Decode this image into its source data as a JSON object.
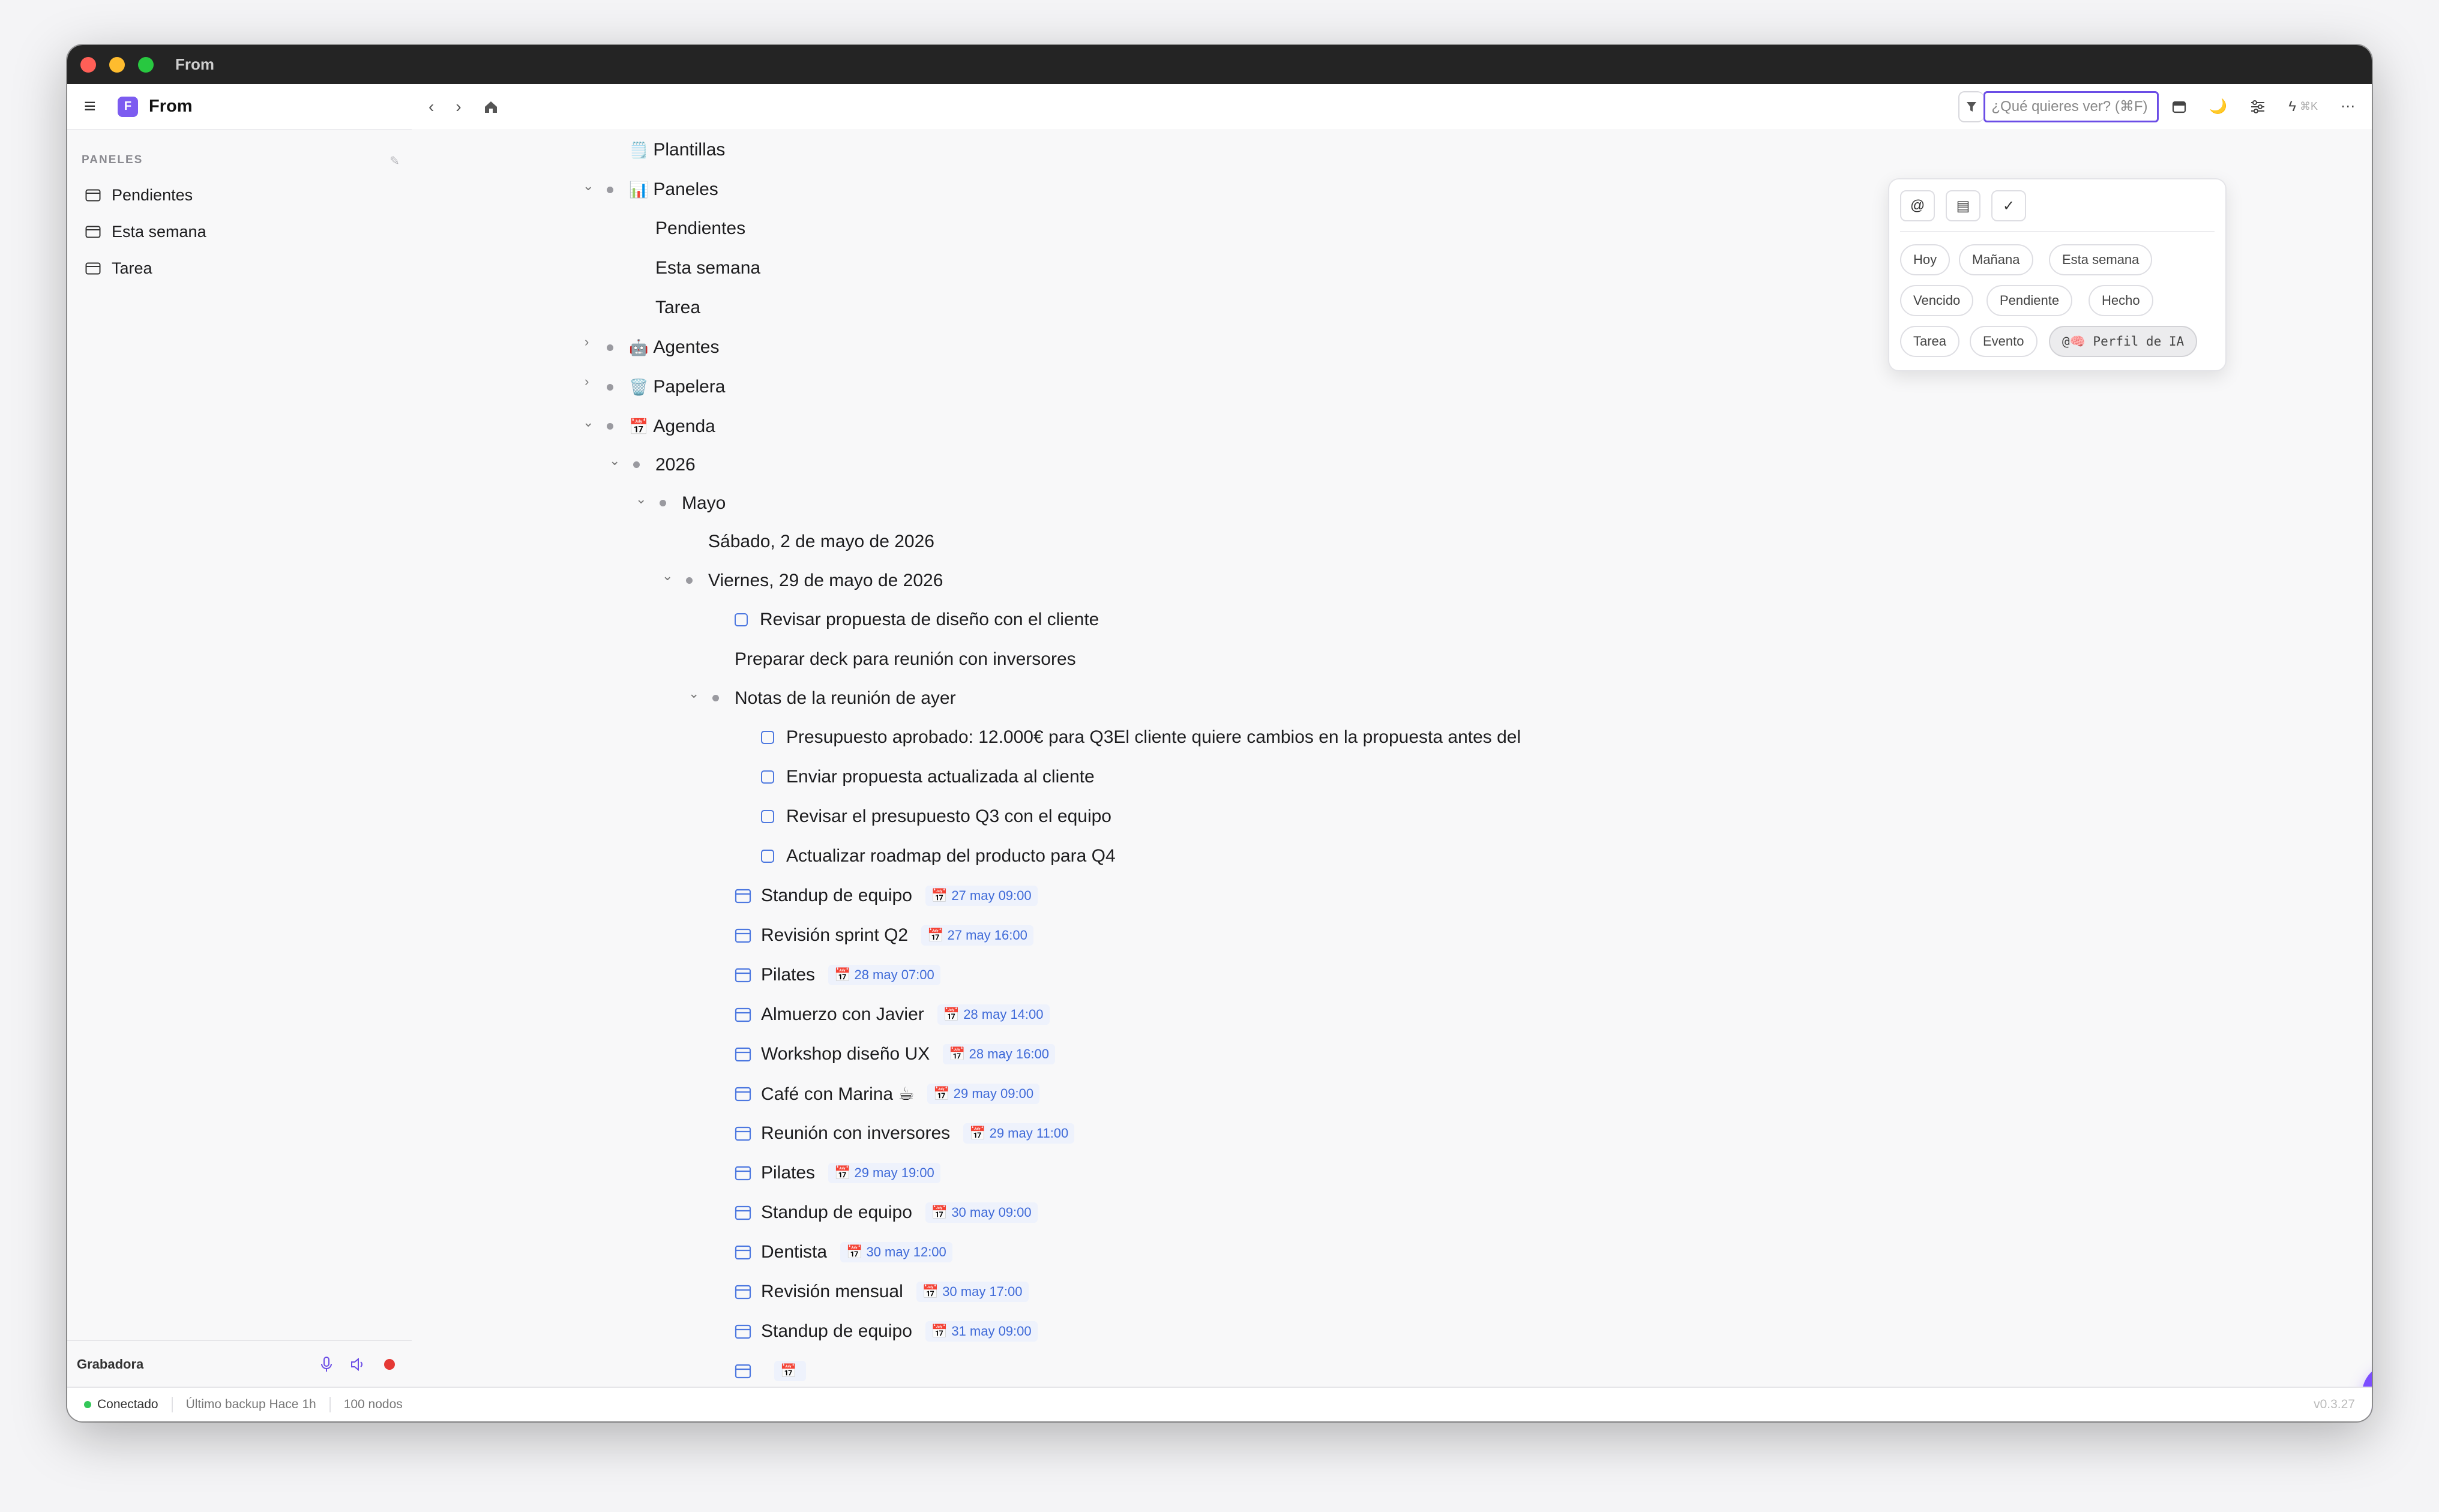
{
  "window": {
    "title": "From"
  },
  "sidebar": {
    "app_badge": "F",
    "app_name": "From",
    "section_label": "PANELES",
    "edit_icon": "✎",
    "items": [
      {
        "label": "Pendientes",
        "icon": "calendar-icon"
      },
      {
        "label": "Esta semana",
        "icon": "calendar-icon"
      },
      {
        "label": "Tarea",
        "icon": "calendar-icon"
      }
    ],
    "recorder_label": "Grabadora"
  },
  "topbar": {
    "search_placeholder": "¿Qué quieres ver? (⌘F)",
    "shortcut": "⌘K"
  },
  "popover": {
    "tools": [
      "@",
      "▤",
      "✓"
    ],
    "chips": [
      "Hoy",
      "Mañana",
      "Esta semana",
      "Vencido",
      "Pendiente",
      "Hecho",
      "Tarea",
      "Evento",
      "@🧠 Perfil de IA"
    ]
  },
  "outline": [
    {
      "text": "Plantillas",
      "emoji": "🗒️"
    },
    {
      "text": "Paneles",
      "emoji": "📊"
    },
    {
      "text": "Pendientes"
    },
    {
      "text": "Esta semana"
    },
    {
      "text": "Tarea"
    },
    {
      "text": "Agentes",
      "emoji": "🤖"
    },
    {
      "text": "Papelera",
      "emoji": "🗑️"
    },
    {
      "text": "Agenda",
      "emoji": "📅"
    },
    {
      "text": "2026"
    },
    {
      "text": "Mayo"
    },
    {
      "text": "Sábado, 2 de mayo de 2026"
    },
    {
      "text": "Viernes, 29 de mayo de 2026"
    },
    {
      "text": "Revisar propuesta de diseño con el cliente"
    },
    {
      "text": "Preparar deck para reunión con inversores"
    },
    {
      "text": "Notas de la reunión de ayer"
    },
    {
      "text": "Presupuesto aprobado: 12.000€ para Q3El cliente quiere cambios en la propuesta antes del"
    },
    {
      "text": "Enviar propuesta actualizada al cliente"
    },
    {
      "text": "Revisar el presupuesto Q3 con el equipo"
    },
    {
      "text": "Actualizar roadmap del producto para Q4"
    },
    {
      "text": "Standup de equipo",
      "date": "27 may 09:00"
    },
    {
      "text": "Revisión sprint Q2",
      "date": "27 may 16:00"
    },
    {
      "text": "Pilates",
      "date": "28 may 07:00"
    },
    {
      "text": "Almuerzo con Javier",
      "date": "28 may 14:00"
    },
    {
      "text": "Workshop diseño UX",
      "date": "28 may 16:00"
    },
    {
      "text": "Café con Marina ☕",
      "date": "29 may 09:00"
    },
    {
      "text": "Reunión con inversores",
      "date": "29 may 11:00"
    },
    {
      "text": "Pilates",
      "date": "29 may 19:00"
    },
    {
      "text": "Standup de equipo",
      "date": "30 may 09:00"
    },
    {
      "text": "Dentista",
      "date": "30 may 12:00"
    },
    {
      "text": "Revisión mensual",
      "date": "30 may 17:00"
    },
    {
      "text": "Standup de equipo",
      "date": "31 may 09:00"
    }
  ],
  "status": {
    "connection": "Conectado",
    "backup": "Último backup Hace 1h",
    "nodes": "100 nodos",
    "version": "v0.3.27"
  },
  "colors": {
    "accent": "#7c4dff",
    "task_blue": "#4d78e0",
    "date_blue": "#3f6ad8"
  }
}
